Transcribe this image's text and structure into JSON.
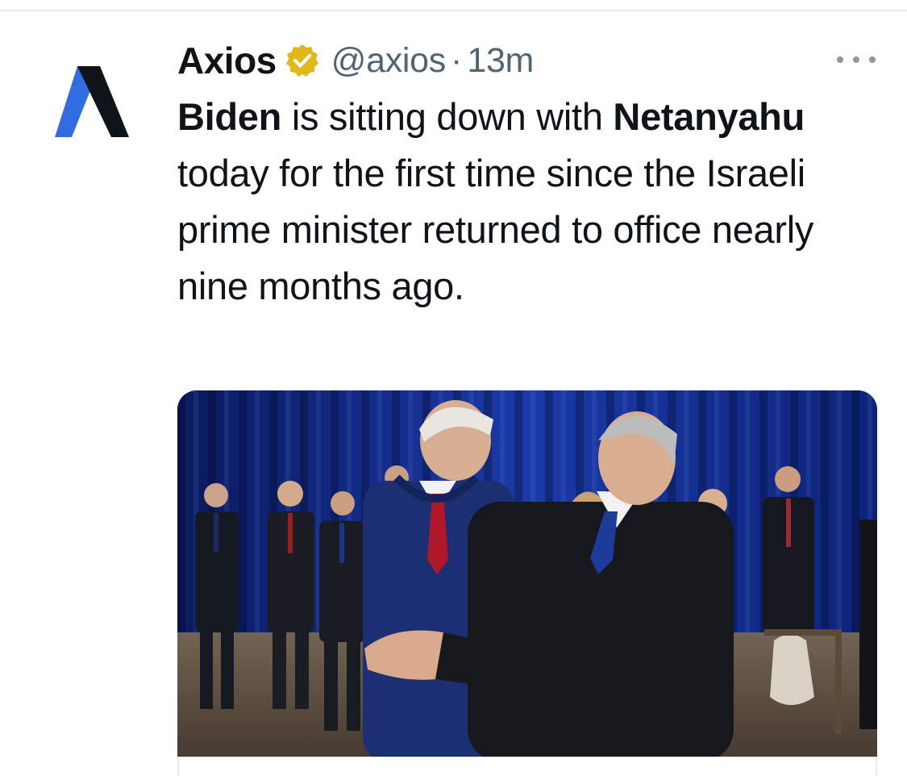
{
  "tweet": {
    "author_name": "Axios",
    "handle": "@axios",
    "separator": "·",
    "timestamp": "13m",
    "verified_badge_icon": "verified-gold-badge-icon",
    "more_icon": "more-options-icon",
    "text": {
      "bold_1": "Biden",
      "part_1": " is sitting down with ",
      "bold_2": "Netanyahu",
      "part_2": " today for the first time since the Israeli prime minister returned to office nearly nine months ago."
    }
  },
  "media": {
    "type": "photo"
  },
  "colors": {
    "verified_gold": "#e2b719",
    "logo_blue": "#2f6de1",
    "logo_black": "#0f1419",
    "muted_text": "#536471"
  }
}
